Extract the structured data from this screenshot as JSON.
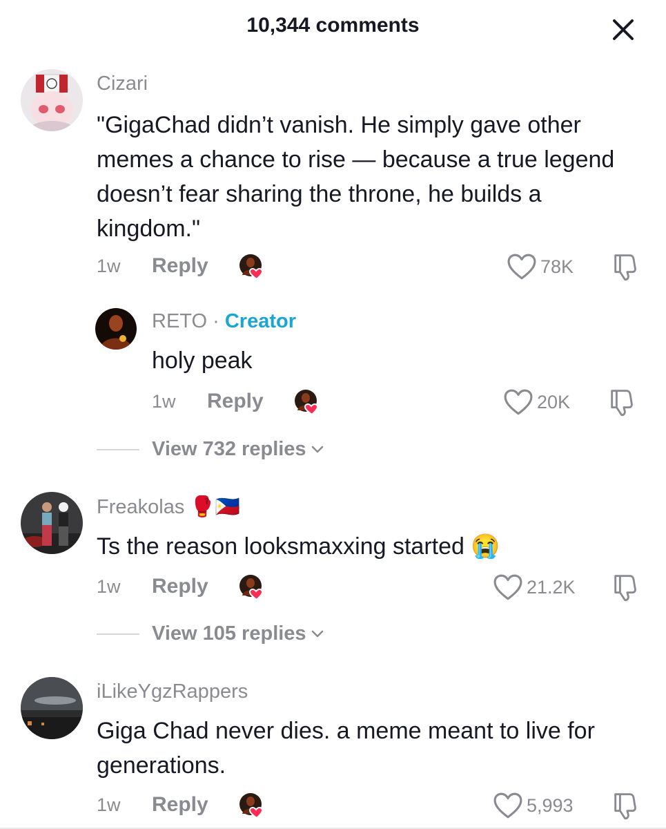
{
  "header": {
    "title": "10,344 comments",
    "close_icon": "close-icon"
  },
  "colors": {
    "creator": "#1aa5d6",
    "secondary_text": "#8a8b91",
    "like_heart": "#fe2c55"
  },
  "comments": [
    {
      "username": "Cizari",
      "text": "\"GigaChad didn’t vanish. He simply gave other memes a chance to rise — because a true legend doesn’t fear sharing the throne, he builds a kingdom.\"",
      "time": "1w",
      "reply_label": "Reply",
      "likes": "78K",
      "replies": [
        {
          "username": "RETO",
          "separator": "·",
          "badge": "Creator",
          "text": "holy peak",
          "time": "1w",
          "reply_label": "Reply",
          "likes": "20K"
        }
      ],
      "view_replies": "View 732 replies"
    },
    {
      "username": "Freakolas",
      "username_emojis": "🥊🇵🇭",
      "text": "Ts the reason looksmaxxing started 😭",
      "time": "1w",
      "reply_label": "Reply",
      "likes": "21.2K",
      "view_replies": "View 105 replies"
    },
    {
      "username": "iLikeYgzRappers",
      "text": "Giga Chad never dies. a meme meant to live for generations.",
      "time": "1w",
      "reply_label": "Reply",
      "likes": "5,993"
    }
  ]
}
